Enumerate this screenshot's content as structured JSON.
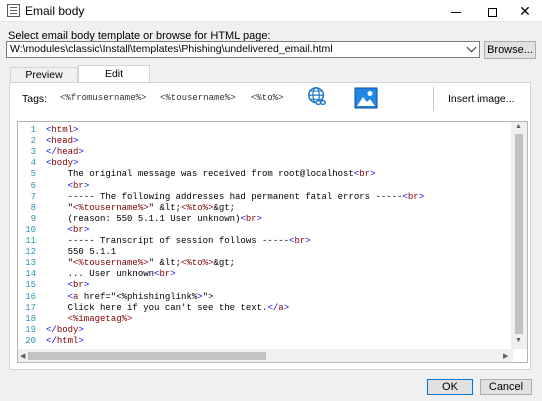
{
  "window": {
    "title": "Email body"
  },
  "select": {
    "label": "Select email body template or browse for HTML page:",
    "value": "W:\\modules\\classic\\Install\\templates\\Phishing\\undelivered_email.html",
    "browse_label": "Browse..."
  },
  "tabs": [
    {
      "label": "Preview"
    },
    {
      "label": "Edit"
    }
  ],
  "toolbar": {
    "tags_label": "Tags:",
    "tags": [
      "<%fromusername%>",
      "<%tousername%>",
      "<%to%>"
    ],
    "insert_image_label": "Insert image..."
  },
  "code": {
    "line_numbers": [
      "1",
      "2",
      "3",
      "4",
      "5",
      "6",
      "7",
      "8",
      "9",
      "10",
      "11",
      "12",
      "13",
      "14",
      "15",
      "16",
      "17",
      "18",
      "19",
      "20"
    ],
    "lines": [
      "<html>",
      "<head>",
      "</head>",
      "<body>",
      "    The original message was received from root@localhost<br>",
      "    <br>",
      "    ----- The following addresses had permanent fatal errors -----<br>",
      "    \"<%tousername%>\" &lt;<%to%>&gt;",
      "    (reason: 550 5.1.1 User unknown)<br>",
      "    <br>",
      "    ----- Transcript of session follows -----<br>",
      "    550 5.1.1",
      "    \"<%tousername%>\" &lt;<%to%>&gt;",
      "    ... User unknown<br>",
      "    <br>",
      "    <a href=\"<%phishinglink%>\">",
      "    Click here if you can't see the text.</a>",
      "    <%imagetag%>",
      "</body>",
      "</html>"
    ]
  },
  "buttons": {
    "ok": "OK",
    "cancel": "Cancel"
  },
  "colors": {
    "tag": "#800000",
    "keyword": "#0000ff",
    "line_number": "#2b91af",
    "accent": "#0078d7"
  }
}
